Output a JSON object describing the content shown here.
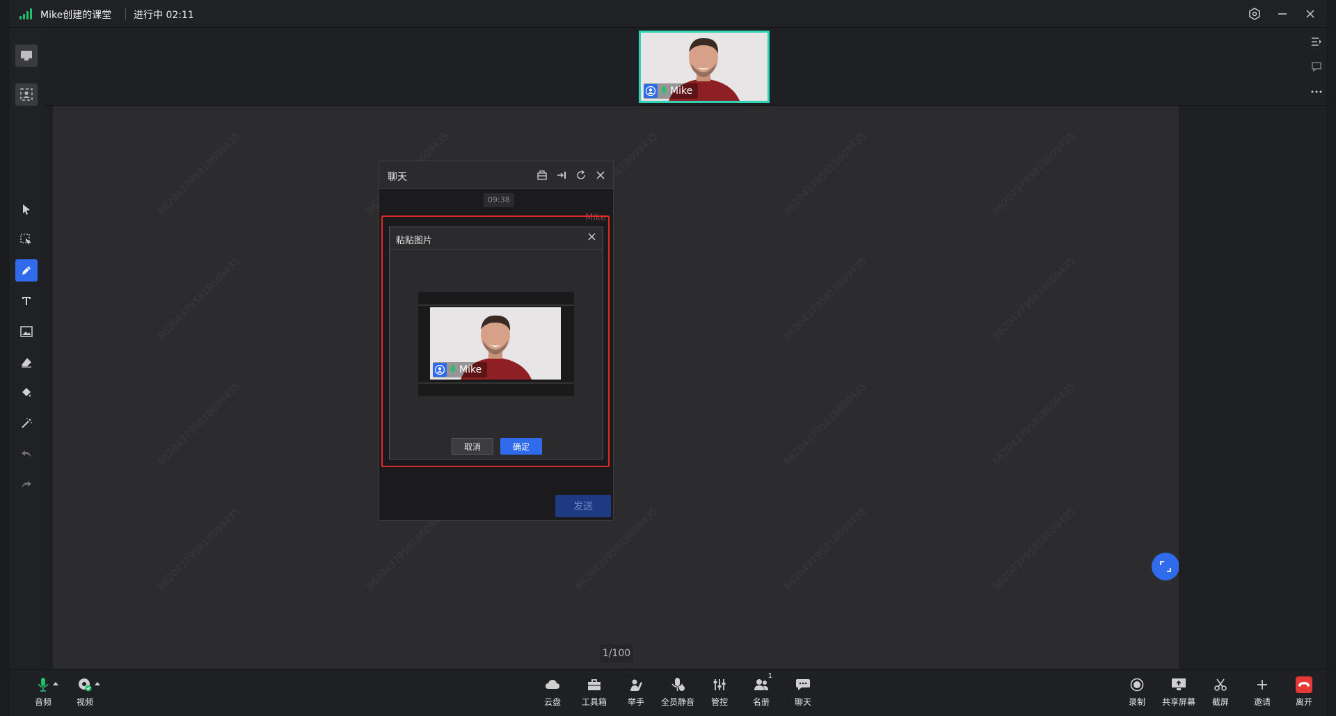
{
  "title_bar": {
    "room_title": "Mike创建的课堂",
    "status": "进行中 02:11"
  },
  "video": {
    "participant_name": "Mike"
  },
  "whiteboard": {
    "watermark": "862043795818609435",
    "page_indicator": "1/100"
  },
  "chat_panel": {
    "title": "聊天",
    "timestamp": "09:38",
    "sender_name": "Mike",
    "send_button": "发送"
  },
  "paste_dialog": {
    "title": "粘贴图片",
    "cancel_button": "取消",
    "confirm_button": "确定",
    "preview_name": "Mike"
  },
  "bottom_bar": {
    "left": [
      {
        "label": "音频",
        "icon": "microphone-icon"
      },
      {
        "label": "视频",
        "icon": "camera-icon"
      }
    ],
    "center": [
      {
        "label": "云盘",
        "icon": "cloud-icon"
      },
      {
        "label": "工具箱",
        "icon": "toolbox-icon"
      },
      {
        "label": "举手",
        "icon": "raise-hand-icon"
      },
      {
        "label": "全员静音",
        "icon": "mute-all-icon"
      },
      {
        "label": "管控",
        "icon": "controls-icon"
      },
      {
        "label": "名册",
        "icon": "roster-icon",
        "badge": "1"
      },
      {
        "label": "聊天",
        "icon": "chat-icon"
      }
    ],
    "right": [
      {
        "label": "录制",
        "icon": "record-icon"
      },
      {
        "label": "共享屏幕",
        "icon": "share-screen-icon"
      },
      {
        "label": "截屏",
        "icon": "scissors-icon"
      },
      {
        "label": "邀请",
        "icon": "plus-icon"
      },
      {
        "label": "离开",
        "icon": "hang-up-icon"
      }
    ]
  },
  "colors": {
    "accent": "#2f6bea",
    "tile_border": "#2fd3b4",
    "signal": "#23c06b",
    "highlight": "#e02828",
    "leave": "#e53935"
  }
}
